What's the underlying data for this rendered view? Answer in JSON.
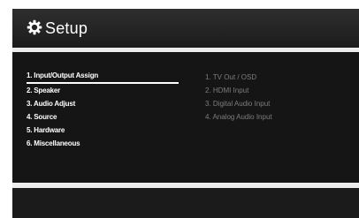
{
  "header": {
    "title": "Setup",
    "icon": "gear-icon"
  },
  "menu": {
    "items": [
      {
        "label": "1. Input/Output Assign",
        "selected": true
      },
      {
        "label": "2. Speaker",
        "selected": false
      },
      {
        "label": "3. Audio Adjust",
        "selected": false
      },
      {
        "label": "4. Source",
        "selected": false
      },
      {
        "label": "5. Hardware",
        "selected": false
      },
      {
        "label": "6. Miscellaneous",
        "selected": false
      }
    ]
  },
  "submenu": {
    "items": [
      {
        "label": "1. TV Out / OSD"
      },
      {
        "label": "2. HDMI Input"
      },
      {
        "label": "3. Digital Audio Input"
      },
      {
        "label": "4. Analog Audio Input"
      }
    ]
  },
  "colors": {
    "header_bg": "#242424",
    "content_bg": "#151515",
    "frame_bg": "#ececec",
    "active_text": "#ffffff",
    "inactive_text": "#7d7d7d"
  }
}
